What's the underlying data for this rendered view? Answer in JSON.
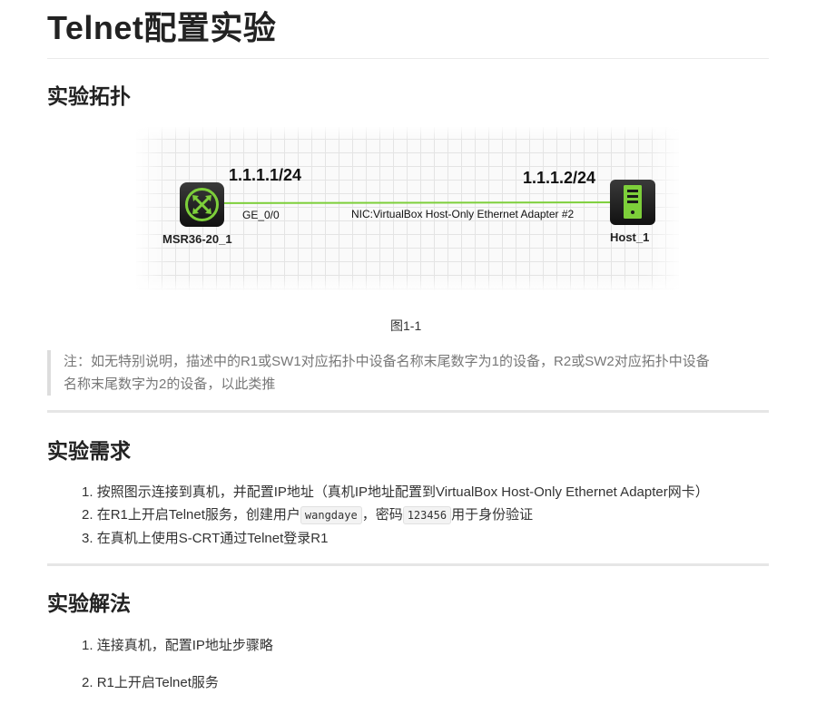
{
  "title": "Telnet配置实验",
  "sections": {
    "topology": {
      "heading": "实验拓扑",
      "figure": {
        "router": {
          "name": "MSR36-20_1",
          "ip": "1.1.1.1/24",
          "port": "GE_0/0",
          "icon": "router-icon"
        },
        "host": {
          "name": "Host_1",
          "ip": "1.1.1.2/24",
          "nic": "NIC:VirtualBox Host-Only Ethernet Adapter #2",
          "icon": "server-icon"
        },
        "link_color": "#7dcf3a"
      },
      "caption": "图1-1",
      "note_line1": "注：如无特别说明，描述中的R1或SW1对应拓扑中设备名称末尾数字为1的设备，R2或SW2对应拓扑中设备",
      "note_line2": "名称末尾数字为2的设备，以此类推"
    },
    "requirements": {
      "heading": "实验需求",
      "items": [
        {
          "num": "1.",
          "text": "按照图示连接到真机，并配置IP地址（真机IP地址配置到VirtualBox Host-Only Ethernet Adapter网卡）"
        },
        {
          "num": "2.",
          "pre": "在R1上开启Telnet服务，创建用户",
          "code1": "wangdaye",
          "mid": "，密码",
          "code2": "123456",
          "post": "用于身份验证"
        },
        {
          "num": "3.",
          "text": "在真机上使用S-CRT通过Telnet登录R1"
        }
      ]
    },
    "solution": {
      "heading": "实验解法",
      "items": [
        {
          "num": "1.",
          "text": "连接真机，配置IP地址步骤略"
        },
        {
          "num": "2.",
          "text": "R1上开启Telnet服务"
        }
      ]
    }
  }
}
